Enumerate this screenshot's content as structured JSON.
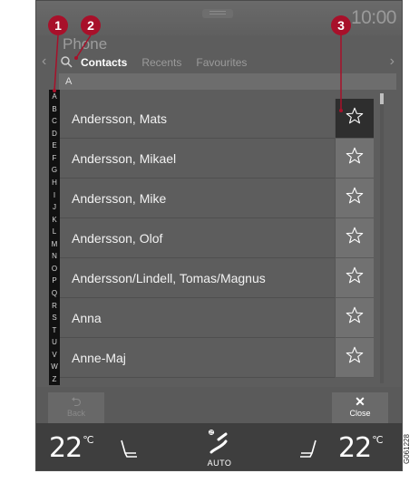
{
  "status_bar": {
    "time": "10:00"
  },
  "app": {
    "title": "Phone"
  },
  "tabs": [
    {
      "label": "Contacts",
      "active": true
    },
    {
      "label": "Recents",
      "active": false
    },
    {
      "label": "Favourites",
      "active": false
    }
  ],
  "section_header": "A",
  "alphabet_index": [
    "A",
    "B",
    "C",
    "D",
    "E",
    "F",
    "G",
    "H",
    "I",
    "J",
    "K",
    "L",
    "M",
    "N",
    "O",
    "P",
    "Q",
    "R",
    "S",
    "T",
    "U",
    "V",
    "W",
    "Z"
  ],
  "contacts": [
    {
      "name": "Andersson, Mats",
      "favourite_selected": true
    },
    {
      "name": "Andersson, Mikael",
      "favourite_selected": false
    },
    {
      "name": "Andersson, Mike",
      "favourite_selected": false
    },
    {
      "name": "Andersson, Olof",
      "favourite_selected": false
    },
    {
      "name": "Andersson/Lindell, Tomas/Magnus",
      "favourite_selected": false
    },
    {
      "name": "Anna",
      "favourite_selected": false
    },
    {
      "name": "Anne-Maj",
      "favourite_selected": false
    }
  ],
  "actions": {
    "back": "Back",
    "close": "Close"
  },
  "climate": {
    "left_temp": "22",
    "right_temp": "22",
    "unit": "°C",
    "fan_mode": "AUTO"
  },
  "callouts": [
    "1",
    "2",
    "3"
  ],
  "figure_code": "G061228",
  "icons": {
    "search": "search-icon",
    "favourite": "star-icon",
    "back": "back-arrow-icon",
    "close": "close-icon",
    "seat": "seat-heat-icon",
    "fan": "fan-icon"
  },
  "colors": {
    "callout": "#a8102a",
    "screen": "#5d5d5d",
    "climate_bar": "#3e3e3e"
  }
}
